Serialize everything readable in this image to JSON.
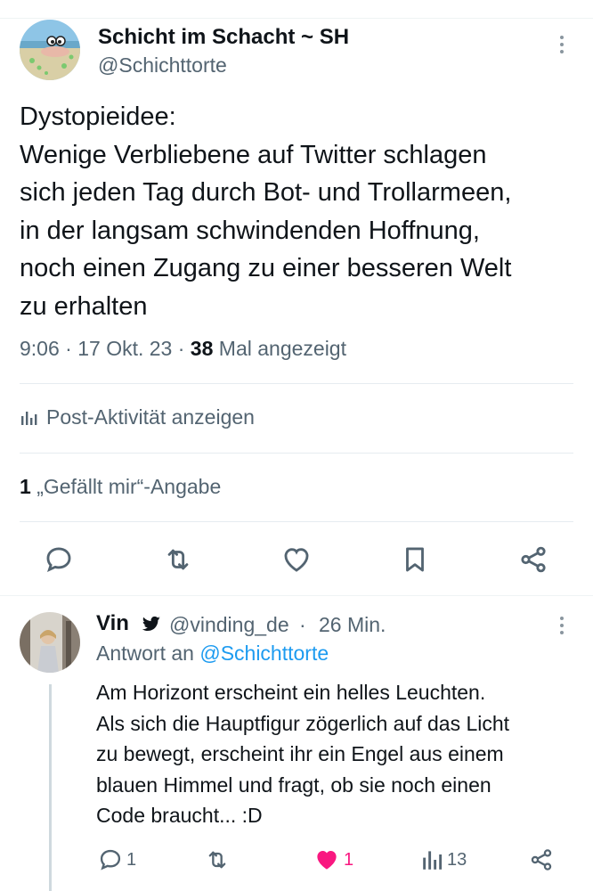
{
  "tweet": {
    "author_name": "Schicht im Schacht ~ SH",
    "author_handle": "@Schichttorte",
    "text_lines": [
      "Dystopieidee:",
      "Wenige Verbliebene auf Twitter schlagen",
      "sich jeden Tag durch Bot- und Trollarmeen,",
      "in der langsam schwindenden Hoffnung,",
      "noch einen Zugang zu einer besseren Welt",
      "zu erhalten"
    ],
    "time": "9:06",
    "date": "17 Okt. 23",
    "views_count": "38",
    "views_label": "Mal angezeigt",
    "activity_label": "Post-Aktivität anzeigen",
    "likes_count": "1",
    "likes_label": "„Gefällt mir“-Angabe",
    "actions": [
      "reply-icon",
      "retweet-icon",
      "like-icon",
      "bookmark-icon",
      "share-icon"
    ]
  },
  "reply": {
    "author_name": "Vin",
    "author_handle": "@vinding_de",
    "time_ago": "26 Min.",
    "reply_to_prefix": "Antwort an",
    "reply_to_handle": "@Schichttorte",
    "text_lines": [
      "Am Horizont erscheint ein helles Leuchten.",
      "Als sich die Hauptfigur zögerlich auf das Licht",
      "zu bewegt, erscheint ihr ein Engel aus einem",
      "blauen Himmel und fragt, ob sie noch einen",
      "Code braucht... :D"
    ],
    "reply_count": "1",
    "like_count": "1",
    "view_count": "13"
  },
  "colors": {
    "text": "#0f1419",
    "secondary": "#536471",
    "accent": "#1d9bf0",
    "like": "#f91880",
    "divider": "#eff3f4"
  }
}
